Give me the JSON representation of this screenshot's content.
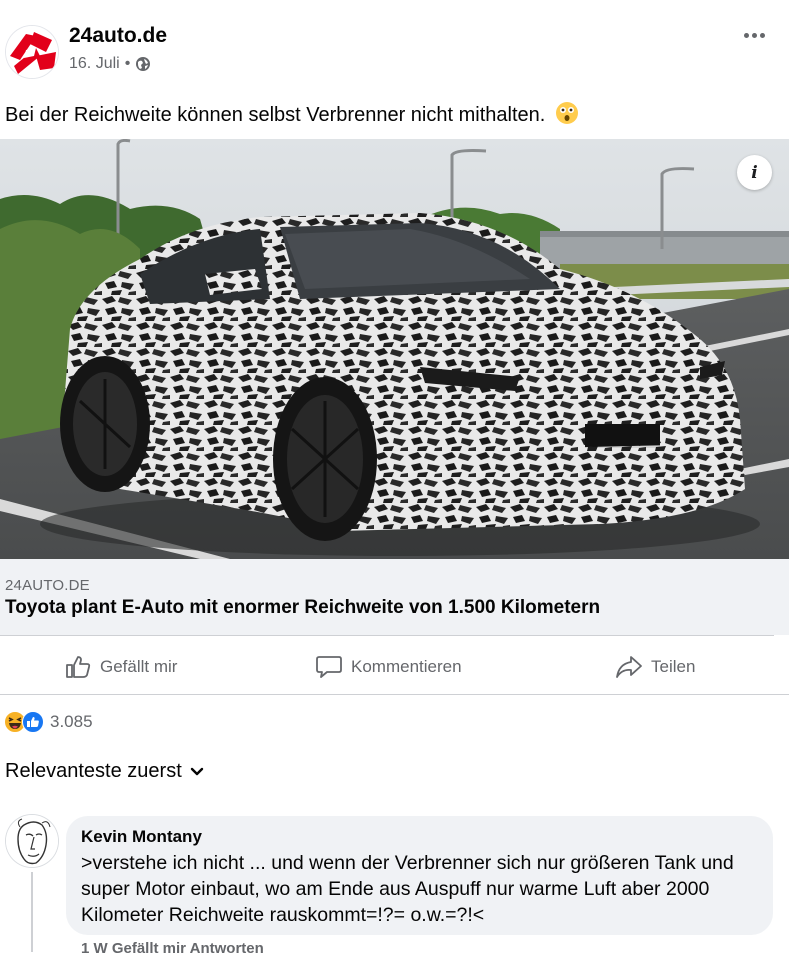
{
  "header": {
    "page_name": "24auto.de",
    "date": "16. Juli",
    "separator": "•",
    "privacy_icon": "globe-icon",
    "more_icon": "more-horizontal-icon"
  },
  "post": {
    "text": "Bei der Reichweite können selbst Verbrenner nicht mithalten.",
    "emoji": "astonished-face-emoji"
  },
  "photo": {
    "info_label": "i"
  },
  "link": {
    "domain": "24AUTO.DE",
    "title": "Toyota plant E-Auto mit enormer Reichweite von 1.500 Kilometern"
  },
  "actions": {
    "like": "Gefällt mir",
    "comment": "Kommentieren",
    "share": "Teilen"
  },
  "reactions": {
    "icons": [
      "haha-reaction-icon",
      "like-reaction-icon"
    ],
    "count": "3.085"
  },
  "sort": {
    "label": "Relevanteste zuerst"
  },
  "comment": {
    "author": "Kevin Montany",
    "text": ">verstehe ich nicht ... und wenn der Verbrenner sich nur größeren Tank und super Motor einbaut, wo am Ende aus Auspuff nur warme Luft aber 2000 Kilometer Reichweite rauskommt=!?= o.w.=?!<",
    "footer_partial": "1 W     Gefällt mir   Antworten"
  },
  "colors": {
    "brand_red": "#e2001a",
    "secondary_text": "#65676b",
    "comment_bubble": "#f0f2f5",
    "like_blue": "#1877f2",
    "haha_yellow": "#f7b125"
  }
}
